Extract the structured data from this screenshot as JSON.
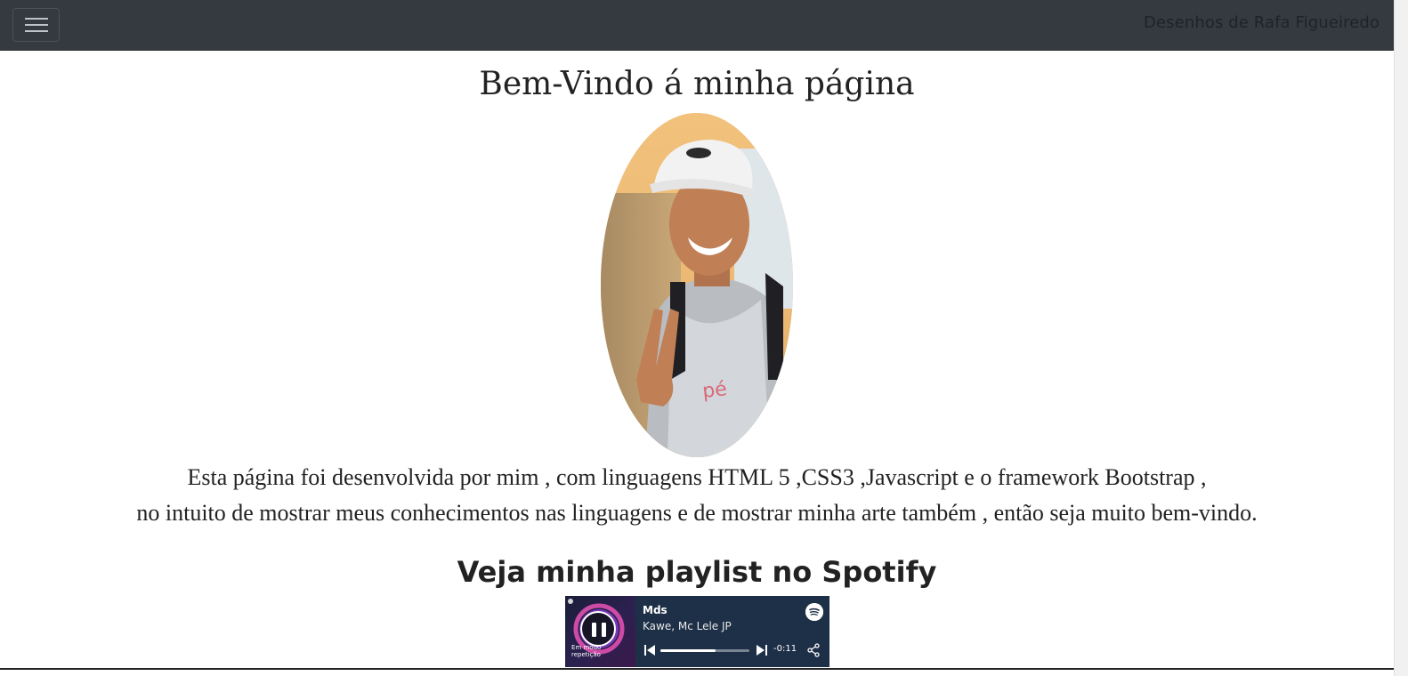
{
  "navbar": {
    "brand": "Desenhos de Rafa Figueiredo",
    "toggler_icon": "hamburger-menu-icon",
    "background_color": "#343a40"
  },
  "main": {
    "title": "Bem-Vindo á minha página",
    "profile_photo": "profile-photo",
    "intro_line_1": "Esta página foi desenvolvida por mim , com linguagens HTML 5 ,CSS3 ,Javascript e o framework Bootstrap ,",
    "intro_line_2": "no intuito de mostrar meus conhecimentos nas linguagens e de mostrar minha arte também , então seja muito bem-vindo.",
    "playlist_heading": "Veja minha playlist no Spotify"
  },
  "spotify_player": {
    "track_title": "Mds",
    "artists": "Kawe, Mc Lele JP",
    "cover_label": "Em modo repetição",
    "time_remaining": "-0:11",
    "progress_fraction": 0.62,
    "state": "playing",
    "icons": {
      "pause": "pause-icon",
      "spotify": "spotify-logo-icon",
      "previous": "previous-track-icon",
      "next": "next-track-icon",
      "share": "share-icon"
    },
    "background_color": "#1e3048"
  }
}
